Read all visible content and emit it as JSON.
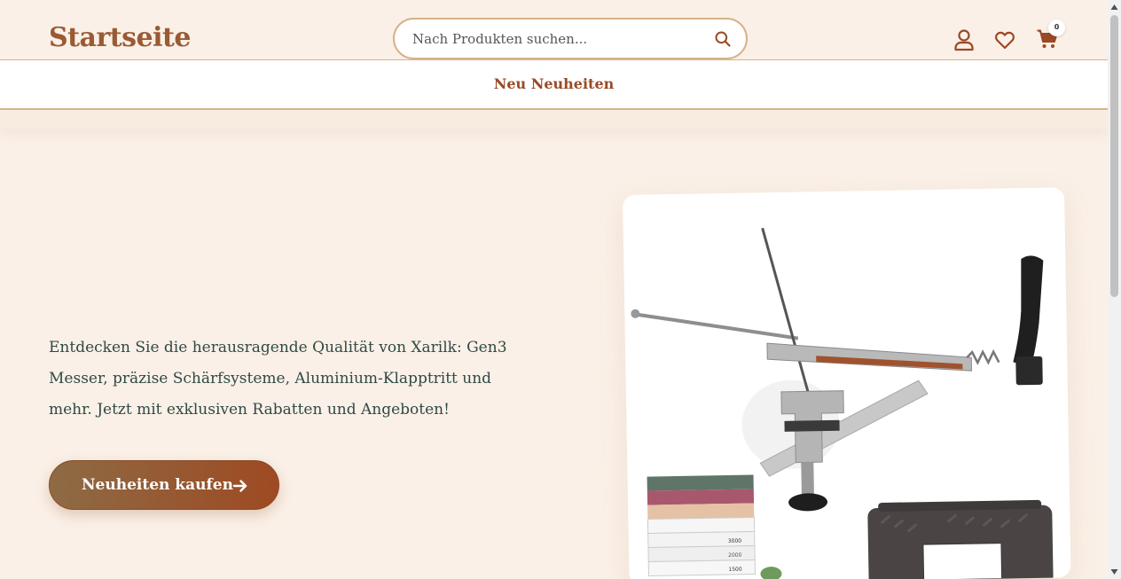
{
  "header": {
    "logo": "Startseite",
    "search": {
      "placeholder": "Nach Produkten suchen...",
      "value": ""
    },
    "cart_count": "0",
    "icons": [
      "search-icon",
      "user-icon",
      "heart-icon",
      "cart-icon"
    ]
  },
  "nav": {
    "link": "Neu Neuheiten"
  },
  "hero": {
    "text": "Entdecken Sie die herausragende Qualität von Xarilk: Gen3 Messer, präzise Schärfsysteme, Aluminium-Klapptritt und mehr. Jetzt mit exklusiven Rabatten und Angeboten!",
    "cta_label": "Neuheiten kaufen",
    "product_image": "knife-sharpener-kit-image",
    "stone_labels": [
      "3000",
      "2000",
      "1500"
    ]
  },
  "colors": {
    "background": "#faf0e7",
    "brand": "#9a5a34",
    "nav_link": "#9a4a24",
    "text": "#2f4a45",
    "cta_start": "#8d6b45",
    "cta_end": "#9e4a22",
    "border": "#d4b48a"
  }
}
